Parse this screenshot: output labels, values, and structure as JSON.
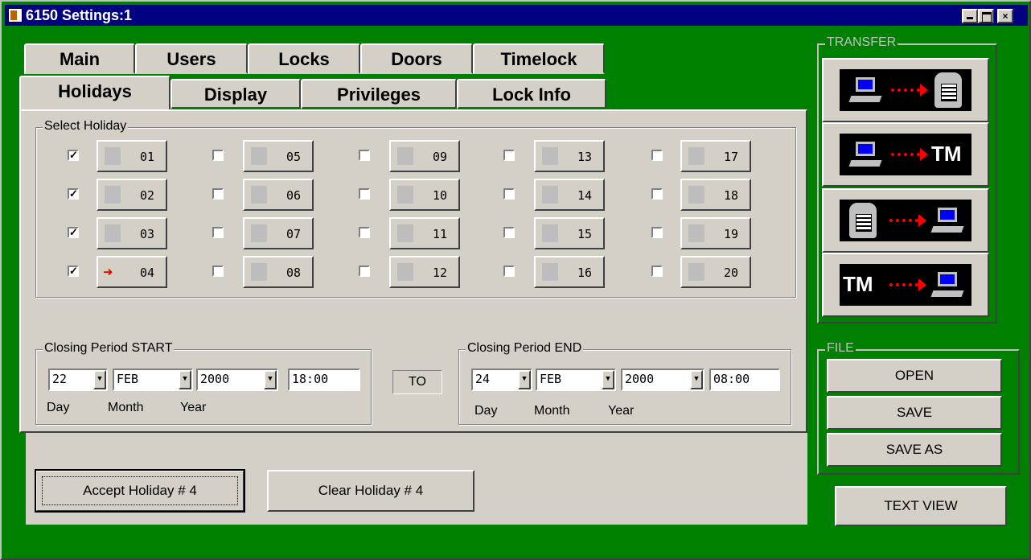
{
  "window": {
    "title": "6150 Settings:1",
    "controls": {
      "minimize": "",
      "maximize": "",
      "close": "×"
    }
  },
  "tabs_row1": [
    "Main",
    "Users",
    "Locks",
    "Doors",
    "Timelock"
  ],
  "tabs_row2": [
    "Holidays",
    "Display",
    "Privileges",
    "Lock Info"
  ],
  "active_tab": "Holidays",
  "select_holiday": {
    "label": "Select Holiday",
    "holidays": [
      {
        "num": "01",
        "checked": true
      },
      {
        "num": "02",
        "checked": true
      },
      {
        "num": "03",
        "checked": true
      },
      {
        "num": "04",
        "checked": true,
        "selected": true
      },
      {
        "num": "05",
        "checked": false
      },
      {
        "num": "06",
        "checked": false
      },
      {
        "num": "07",
        "checked": false
      },
      {
        "num": "08",
        "checked": false
      },
      {
        "num": "09",
        "checked": false
      },
      {
        "num": "10",
        "checked": false
      },
      {
        "num": "11",
        "checked": false
      },
      {
        "num": "12",
        "checked": false
      },
      {
        "num": "13",
        "checked": false
      },
      {
        "num": "14",
        "checked": false
      },
      {
        "num": "15",
        "checked": false
      },
      {
        "num": "16",
        "checked": false
      },
      {
        "num": "17",
        "checked": false
      },
      {
        "num": "18",
        "checked": false
      },
      {
        "num": "19",
        "checked": false
      },
      {
        "num": "20",
        "checked": false
      }
    ]
  },
  "closing_start": {
    "label": "Closing Period START",
    "day": "22",
    "month": "FEB",
    "year": "2000",
    "time": "18:00",
    "day_label": "Day",
    "month_label": "Month",
    "year_label": "Year"
  },
  "to_label": "TO",
  "closing_end": {
    "label": "Closing Period END",
    "day": "24",
    "month": "FEB",
    "year": "2000",
    "time": "08:00",
    "day_label": "Day",
    "month_label": "Month",
    "year_label": "Year"
  },
  "accept_label": "Accept Holiday # 4",
  "clear_label": "Clear Holiday # 4",
  "transfer": {
    "label": "TRANSFER",
    "tm_text": "TM"
  },
  "file": {
    "label": "FILE",
    "open": "OPEN",
    "save": "SAVE",
    "save_as": "SAVE AS"
  },
  "text_view": "TEXT VIEW",
  "colors": {
    "background": "#008000",
    "titlebar": "#000080",
    "face": "#d4d0c8",
    "arrow": "#e00000"
  }
}
